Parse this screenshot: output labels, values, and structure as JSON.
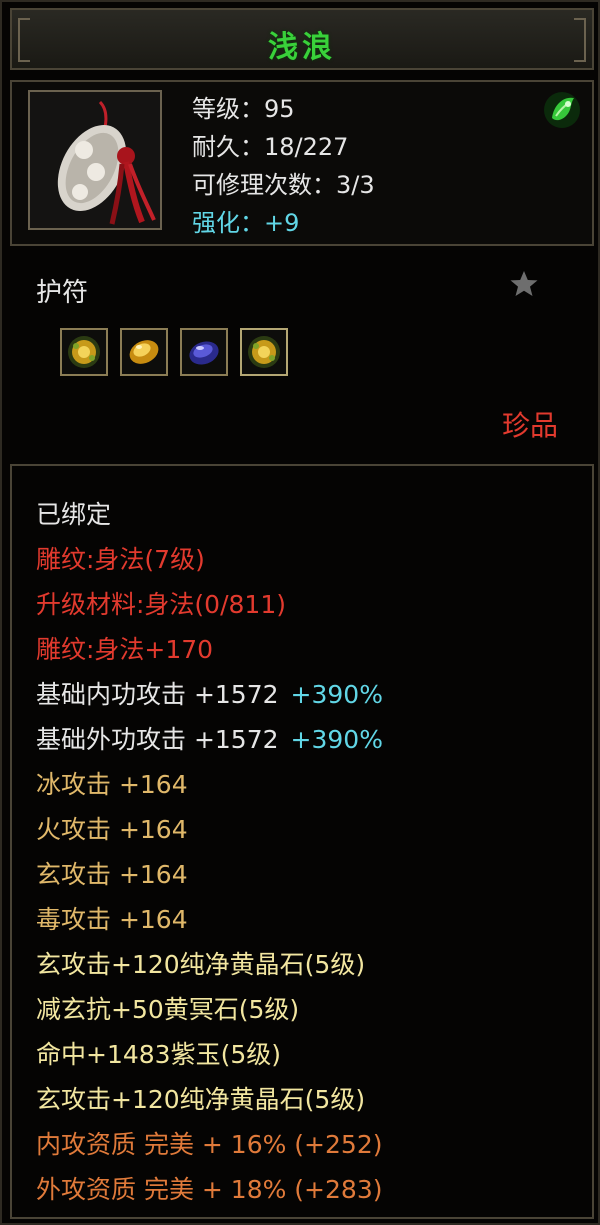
{
  "item": {
    "name": "浅浪",
    "stats": {
      "level": "等级：95",
      "durability": "耐久：18/227",
      "repairs": "可修理次数：3/3",
      "enhance": "强化：+9"
    },
    "type": "护符",
    "rarity": "珍品",
    "gems": [
      {
        "icon": "amber-flower-gem-icon"
      },
      {
        "icon": "gold-crystal-gem-icon"
      },
      {
        "icon": "purple-jade-gem-icon"
      },
      {
        "icon": "amber-flower-gem-icon"
      }
    ]
  },
  "attributes": [
    {
      "text": "已绑定",
      "pct": "",
      "color": "white"
    },
    {
      "text": "雕纹:身法(7级)",
      "pct": "",
      "color": "red"
    },
    {
      "text": "升级材料:身法(0/811)",
      "pct": "",
      "color": "red"
    },
    {
      "text": "雕纹:身法+170",
      "pct": "",
      "color": "red"
    },
    {
      "text": "基础内功攻击  +1572",
      "pct": "+390%",
      "color": "white"
    },
    {
      "text": "基础外功攻击  +1572",
      "pct": "+390%",
      "color": "white"
    },
    {
      "text": "冰攻击  +164",
      "pct": "",
      "color": "gold"
    },
    {
      "text": "火攻击  +164",
      "pct": "",
      "color": "gold"
    },
    {
      "text": "玄攻击  +164",
      "pct": "",
      "color": "gold"
    },
    {
      "text": "毒攻击  +164",
      "pct": "",
      "color": "gold"
    },
    {
      "text": "玄攻击+120纯净黄晶石(5级)",
      "pct": "",
      "color": "yellow"
    },
    {
      "text": "减玄抗+50黄冥石(5级)",
      "pct": "",
      "color": "yellow"
    },
    {
      "text": "命中+1483紫玉(5级)",
      "pct": "",
      "color": "yellow"
    },
    {
      "text": "玄攻击+120纯净黄晶石(5级)",
      "pct": "",
      "color": "yellow"
    },
    {
      "text": "内攻资质  完美  +  16% (+252)",
      "pct": "",
      "color": "orange"
    },
    {
      "text": "外攻资质  完美  +  18% (+283)",
      "pct": "",
      "color": "orange"
    }
  ],
  "colors": {
    "title": "#39d13a",
    "white": "#e6e6e6",
    "red": "#e23a2e",
    "gold": "#e0b86a",
    "yellow": "#f2e6a0",
    "orange": "#e07a3a",
    "cyan": "#61d6e6"
  }
}
